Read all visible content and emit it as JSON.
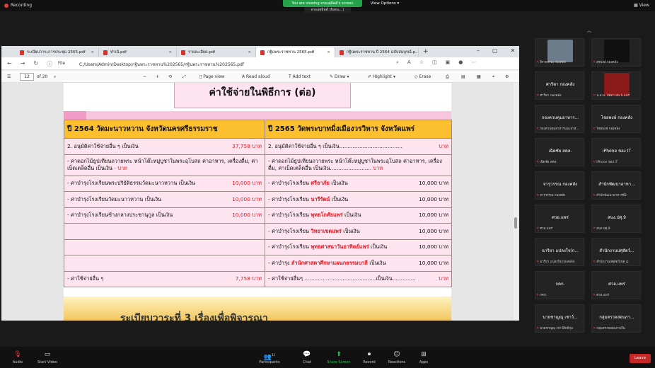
{
  "meeting": {
    "recording_label": "Recording",
    "share_banner": "You are viewing ครองศุลิตต์'s screen",
    "view_options": "View Options ▾",
    "presenter_label": "ครองศุลิตต์ (ผิงตน...)",
    "view_label": "View",
    "leave_label": "Leave"
  },
  "browser": {
    "tabs": [
      {
        "label": "ระเบียบวาระการประชุม 2565.pdf"
      },
      {
        "label": "ทำเนิ.pdf"
      },
      {
        "label": "รายละเอียด.pdf"
      },
      {
        "label": "กฐินพระราชทาน 2565.pdf"
      },
      {
        "label": "กฐินพระราชทาน ปี 2564 ฉบับสมบูรณ์.p..."
      }
    ],
    "file_label": "File",
    "url": "C:/Users/Admin/Desktop/กฐินพระราชทาน%202565/กฐินพระราชทาน%202565.pdf",
    "page_number": "12",
    "page_total": "of 20",
    "toolbar": {
      "page_view": "Page view",
      "read_aloud": "Read aloud",
      "add_text": "Add text",
      "draw": "Draw",
      "highlight": "Highlight",
      "erase": "Erase"
    }
  },
  "slide": {
    "title": "ค่าใช้จ่ายในพิธีการ (ต่อ)",
    "col_left": "ปี 2564 วัดมะนาวหวาน จังหวัดนครศรีธรรมราช",
    "col_right": "ปี 2565 วัดพระบาทมิ่งเมืองวรวิหาร จังหวัดแพร่",
    "rows": [
      {
        "left": "2. อนุมัติค่าใช้จ่ายอื่น ๆ เป็นเงิน",
        "left_amt": "37,758 บาท",
        "right": "2. อนุมัติค่าใช้จ่ายอื่น ๆ เป็นเงิน......................................",
        "right_amt": "บาท"
      },
      {
        "left": "- ค่าดอกไม้ธูปเทียนถวายพระ หน้าโต๊ะหมู่บูชาในพระอุโบสถ ค่าอาหาร, เครื่องดื่ม, ค่าเบ็ดเตล็ดอื่น เป็นเงิน",
        "left_amt": "- บาท",
        "right": "- ค่าดอกไม้ธูปเทียนถวายพระ หน้าโต๊ะหมู่บูชาในพระอุโบสถ ค่าอาหาร, เครื่องดื่ม, ค่าเบ็ดเตล็ดอื่น เป็นเงิน.........................",
        "right_amt": "บาท"
      },
      {
        "left": "- ค่าบำรุงโรงเรียนพระปริยัติธรรมวัดมะนาวหวาน เป็นเงิน",
        "left_amt": "10,000 บาท",
        "right_pre": "- ค่าบำรุงโรงเรียน ",
        "right_red": "ศรีธาภัย",
        "right_post": " เป็นเงิน",
        "right_amt": "10,000 บาท"
      },
      {
        "left": "- ค่าบำรุงโรงเรียนวัดมะนาวหวาน เป็นเงิน",
        "left_amt": "10,000 บาท",
        "right_pre": "- ค่าบำรุงโรงเรียน ",
        "right_red": "นารีรัตน์",
        "right_post": " เป็นเงิน",
        "right_amt": "10,000 บาท"
      },
      {
        "left": "- ค่าบำรุงโรงเรียนช้างกลางประชานุกูล เป็นเงิน",
        "left_amt": "10,000 บาท",
        "right_pre": "- ค่าบำรุงโรงเรียน ",
        "right_red": "พุทธโกศัยแพร่",
        "right_post": " เป็นเงิน",
        "right_amt": "10,000 บาท"
      },
      {
        "left": "",
        "left_amt": "",
        "right_pre": "- ค่าบำรุงโรงเรียน ",
        "right_red": "วิทยาเขตแพร่",
        "right_post": " เป็นเงิน",
        "right_amt": "10,000 บาท"
      },
      {
        "left": "",
        "left_amt": "",
        "right_pre": "- ค่าบำรุงโรงเรียน ",
        "right_red": "พุทธศาสนาวันอาทิตย์แพร่",
        "right_post": " เป็นเงิน",
        "right_amt": "10,000 บาท"
      },
      {
        "left": "",
        "left_amt": "",
        "right_pre": "- ค่าบำรุง ",
        "right_red": "สำนักศาสตาศึกษาแผนกธรรมบาลี",
        "right_post": " เป็นเงิน",
        "right_amt": "10,000 บาท"
      },
      {
        "left": "- ค่าใช้จ่ายอื่น ๆ",
        "left_amt": "7,758 บาท",
        "right": "- ค่าใช้จ่ายอื่นๆ ...........................................เป็นเงิน..............",
        "right_amt": "บาท"
      }
    ],
    "next_agenda": "ระเบียบวาระที่ 3 เรื่องเพื่อพิจารณา"
  },
  "participants": [
    {
      "name": "",
      "label": "จิราพรรณ กองคลัง",
      "color": "#6d7c8a"
    },
    {
      "name": "",
      "label": "สุรพงษ์ กองคลัง",
      "color": "#111111"
    },
    {
      "name": "ศาริตา กองคลัง",
      "label": "ศาริตา กองคลัง",
      "color": ""
    },
    {
      "name": "",
      "label": "น.ส.พ. ภัสดา สพ.ป.แพร่",
      "color": "#8a1a1a"
    },
    {
      "name": "กองควบคุมอาหาร...",
      "label": "กองควบคุมอาหารและยาสั...",
      "color": ""
    },
    {
      "name": "ไชยพงษ์ กองคลัง",
      "label": "ไชยพงษ์ กองคลัง",
      "color": ""
    },
    {
      "name": "เฉิดชัย สคล.",
      "label": "เฉิดชัย สคล.",
      "color": ""
    },
    {
      "name": "iPhone ของ IT",
      "label": "iPhone ของ IT",
      "color": ""
    },
    {
      "name": "จารุวรรณ กองคลัง",
      "label": "จารุวรรณ กองคลัง",
      "color": ""
    },
    {
      "name": "สำนักพัฒนาอาหา...",
      "label": "สำนักพัฒนาอาหารที่2",
      "color": ""
    },
    {
      "name": "ศวอ.แพร่",
      "label": "ศวอ.แพร่",
      "color": ""
    },
    {
      "name": "สนง.ปศุ.9",
      "label": "สนง.ปศุ.9",
      "color": ""
    },
    {
      "name": "ฉาริยา แปลงใจ(ก...",
      "label": "ฉาริยา แปลงใจ(กองคลัง)",
      "color": ""
    },
    {
      "name": "สำนักงานปศุสัตว์...",
      "label": "สำนักงานปศุสัตว์เขต ๘",
      "color": ""
    },
    {
      "name": "กคก.",
      "label": "กคก.",
      "color": ""
    },
    {
      "name": "ศวอ.แพร่",
      "label": "ศวอ.แพร่",
      "color": ""
    },
    {
      "name": "นายชาญณุ เชาว์...",
      "label": "นายชาญณุ เชาว์สิทธิกุล",
      "color": ""
    },
    {
      "name": "กลุ่มตรวจสอบภา...",
      "label": "กลุ่มตรวจสอบภายใน",
      "color": ""
    }
  ],
  "controls": {
    "audio": "Audio",
    "video": "Start Video",
    "participants": "Participants",
    "participants_count": "11",
    "chat": "Chat",
    "share": "Share Screen",
    "record": "Record",
    "reactions": "Reactions",
    "apps": "Apps"
  }
}
